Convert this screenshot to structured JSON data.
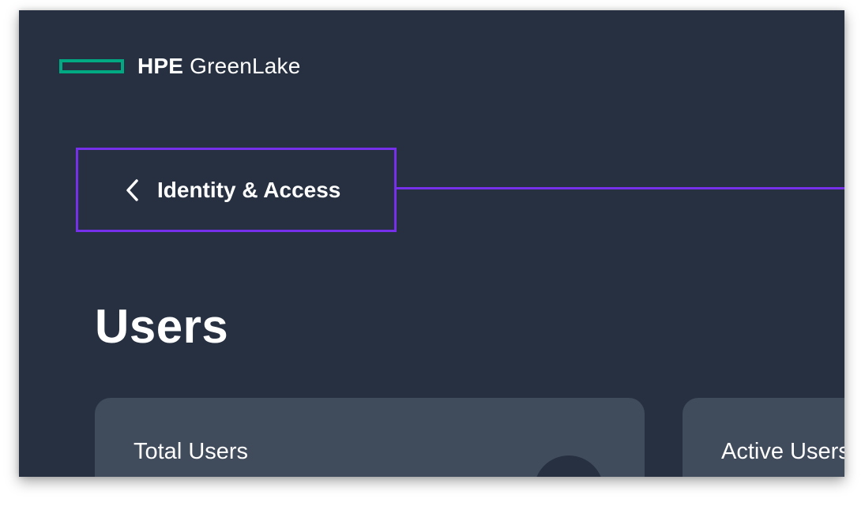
{
  "brand": {
    "company": "HPE",
    "product": "GreenLake",
    "mark_color": "#01a982"
  },
  "navigation": {
    "back_label": "Identity & Access",
    "back_icon": "chevron-left-icon",
    "highlight_color": "#7630ea"
  },
  "page": {
    "title": "Users"
  },
  "cards": [
    {
      "title": "Total Users"
    },
    {
      "title": "Active Users"
    }
  ],
  "colors": {
    "background": "#263040",
    "card": "#404b5c",
    "text": "#ffffff"
  }
}
